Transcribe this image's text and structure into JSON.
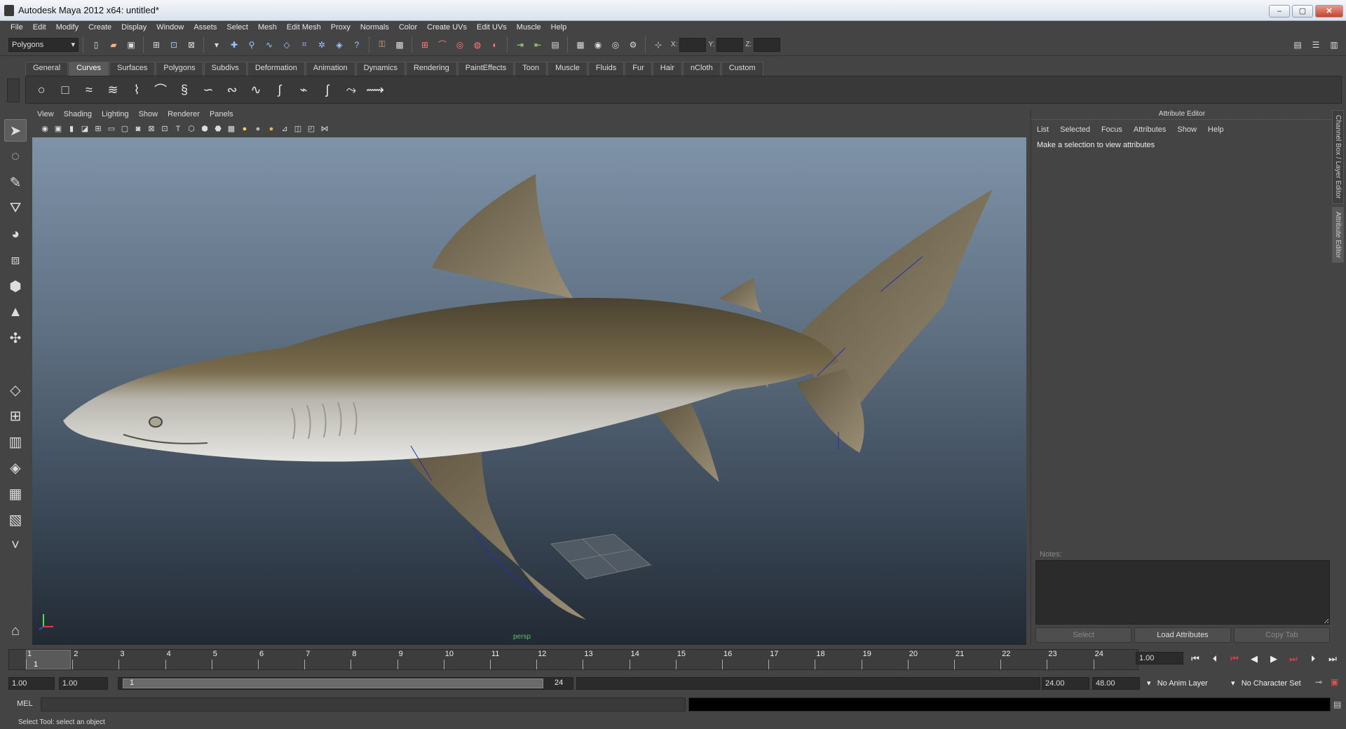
{
  "window": {
    "title": "Autodesk Maya 2012 x64: untitled*"
  },
  "menu": [
    "File",
    "Edit",
    "Modify",
    "Create",
    "Display",
    "Window",
    "Assets",
    "Select",
    "Mesh",
    "Edit Mesh",
    "Proxy",
    "Normals",
    "Color",
    "Create UVs",
    "Edit UVs",
    "Muscle",
    "Help"
  ],
  "status": {
    "menuset": "Polygons",
    "x_label": "X:",
    "y_label": "Y:",
    "z_label": "Z:"
  },
  "shelf_tabs": [
    "General",
    "Curves",
    "Surfaces",
    "Polygons",
    "Subdivs",
    "Deformation",
    "Animation",
    "Dynamics",
    "Rendering",
    "PaintEffects",
    "Toon",
    "Muscle",
    "Fluids",
    "Fur",
    "Hair",
    "nCloth",
    "Custom"
  ],
  "shelf_active": "Curves",
  "viewport": {
    "menu": [
      "View",
      "Shading",
      "Lighting",
      "Show",
      "Renderer",
      "Panels"
    ],
    "camera": "persp"
  },
  "attribute_editor": {
    "title": "Attribute Editor",
    "menu": [
      "List",
      "Selected",
      "Focus",
      "Attributes",
      "Show",
      "Help"
    ],
    "message": "Make a selection to view attributes",
    "notes_label": "Notes:",
    "buttons": {
      "select": "Select",
      "load": "Load Attributes",
      "copy": "Copy Tab"
    }
  },
  "side_tabs": [
    "Channel Box / Layer Editor",
    "Attribute Editor"
  ],
  "timeline": {
    "ticks": [
      "1",
      "2",
      "3",
      "4",
      "5",
      "6",
      "7",
      "8",
      "9",
      "10",
      "11",
      "12",
      "13",
      "14",
      "15",
      "16",
      "17",
      "18",
      "19",
      "20",
      "21",
      "22",
      "23",
      "24"
    ],
    "current_frame": "1",
    "current_field": "1.00",
    "start": "1.00",
    "start2": "1.00",
    "range_start": "1",
    "range_end": "24",
    "end": "24.00",
    "end2": "48.00",
    "anim_layer": "No Anim Layer",
    "char_set": "No Character Set"
  },
  "cmd": {
    "label": "MEL"
  },
  "help_line": "Select Tool: select an object"
}
